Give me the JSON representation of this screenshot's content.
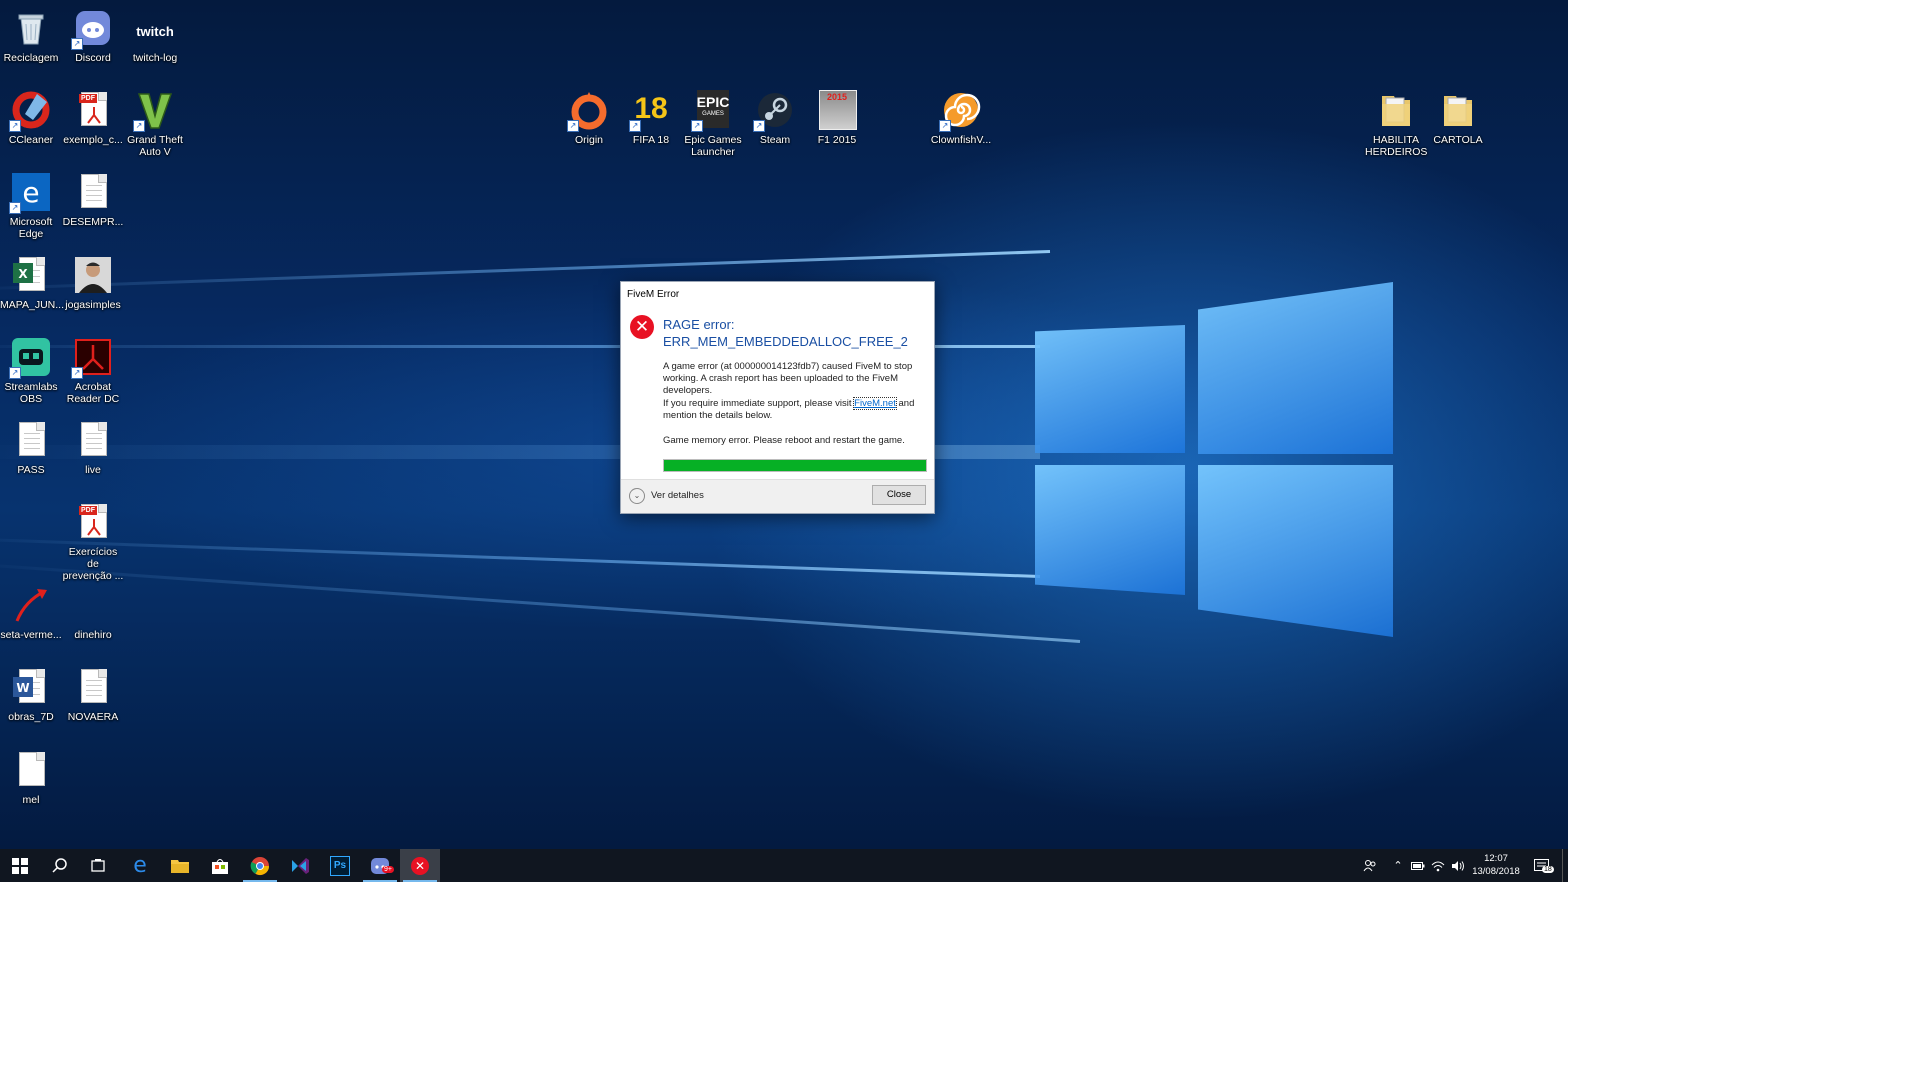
{
  "desktop_icons": {
    "recycle": "Reciclagem",
    "discord": "Discord",
    "twitch_log": "twitch-log",
    "twitch_logo_text": "twitch",
    "ccleaner": "CCleaner",
    "exemplo": "exemplo_c...",
    "gta": "Grand Theft Auto V",
    "edge": "Microsoft Edge",
    "desempr": "DESEMPR...",
    "mapa": "MAPA_JUN...",
    "jogasimples": "jogasimples",
    "streamlabs": "Streamlabs OBS",
    "acrobat": "Acrobat Reader DC",
    "pass": "PASS",
    "live": "live",
    "exercicios": "Exercícios de prevenção ...",
    "seta": "seta-verme...",
    "dinehiro": "dinehiro",
    "obras": "obras_7D",
    "novaera": "NOVAERA",
    "mel": "mel",
    "origin": "Origin",
    "fifa": "FIFA 18",
    "fifa_logo_text": "18",
    "epic": "Epic Games Launcher",
    "epic_logo_text": "EPIC",
    "epic_logo_sub": "GAMES",
    "steam": "Steam",
    "f1": "F1 2015",
    "f1_logo_text": "2015",
    "clownfish": "ClownfishV...",
    "habilita": "HABILITA HERDEIROS",
    "cartola": "CARTOLA",
    "pdf_badge": "PDF"
  },
  "dialog": {
    "title": "FiveM Error",
    "heading_line1": "RAGE error:",
    "heading_line2": "ERR_MEM_EMBEDDEDALLOC_FREE_2",
    "body_part1": "A game error (at 000000014123fdb7) caused FiveM to stop working. A crash report has been uploaded to the FiveM developers.",
    "body_part2": "If you require immediate support, please visit ",
    "link_text": "FiveM.net",
    "body_part3": " and mention the details below.",
    "memory_error": "Game memory error. Please reboot and restart the game.",
    "progress_fraction": 1.0,
    "details_label": "Ver detalhes",
    "close_label": "Close"
  },
  "taskbar": {
    "photoshop_label": "Ps",
    "discord_badge": "9+",
    "notification_count": "18",
    "clock_time": "12:07",
    "clock_date": "13/08/2018"
  },
  "colors": {
    "accent": "#1a4fa3",
    "error_red": "#e81123",
    "progress_green": "#06b025",
    "taskbar": "#101620"
  }
}
